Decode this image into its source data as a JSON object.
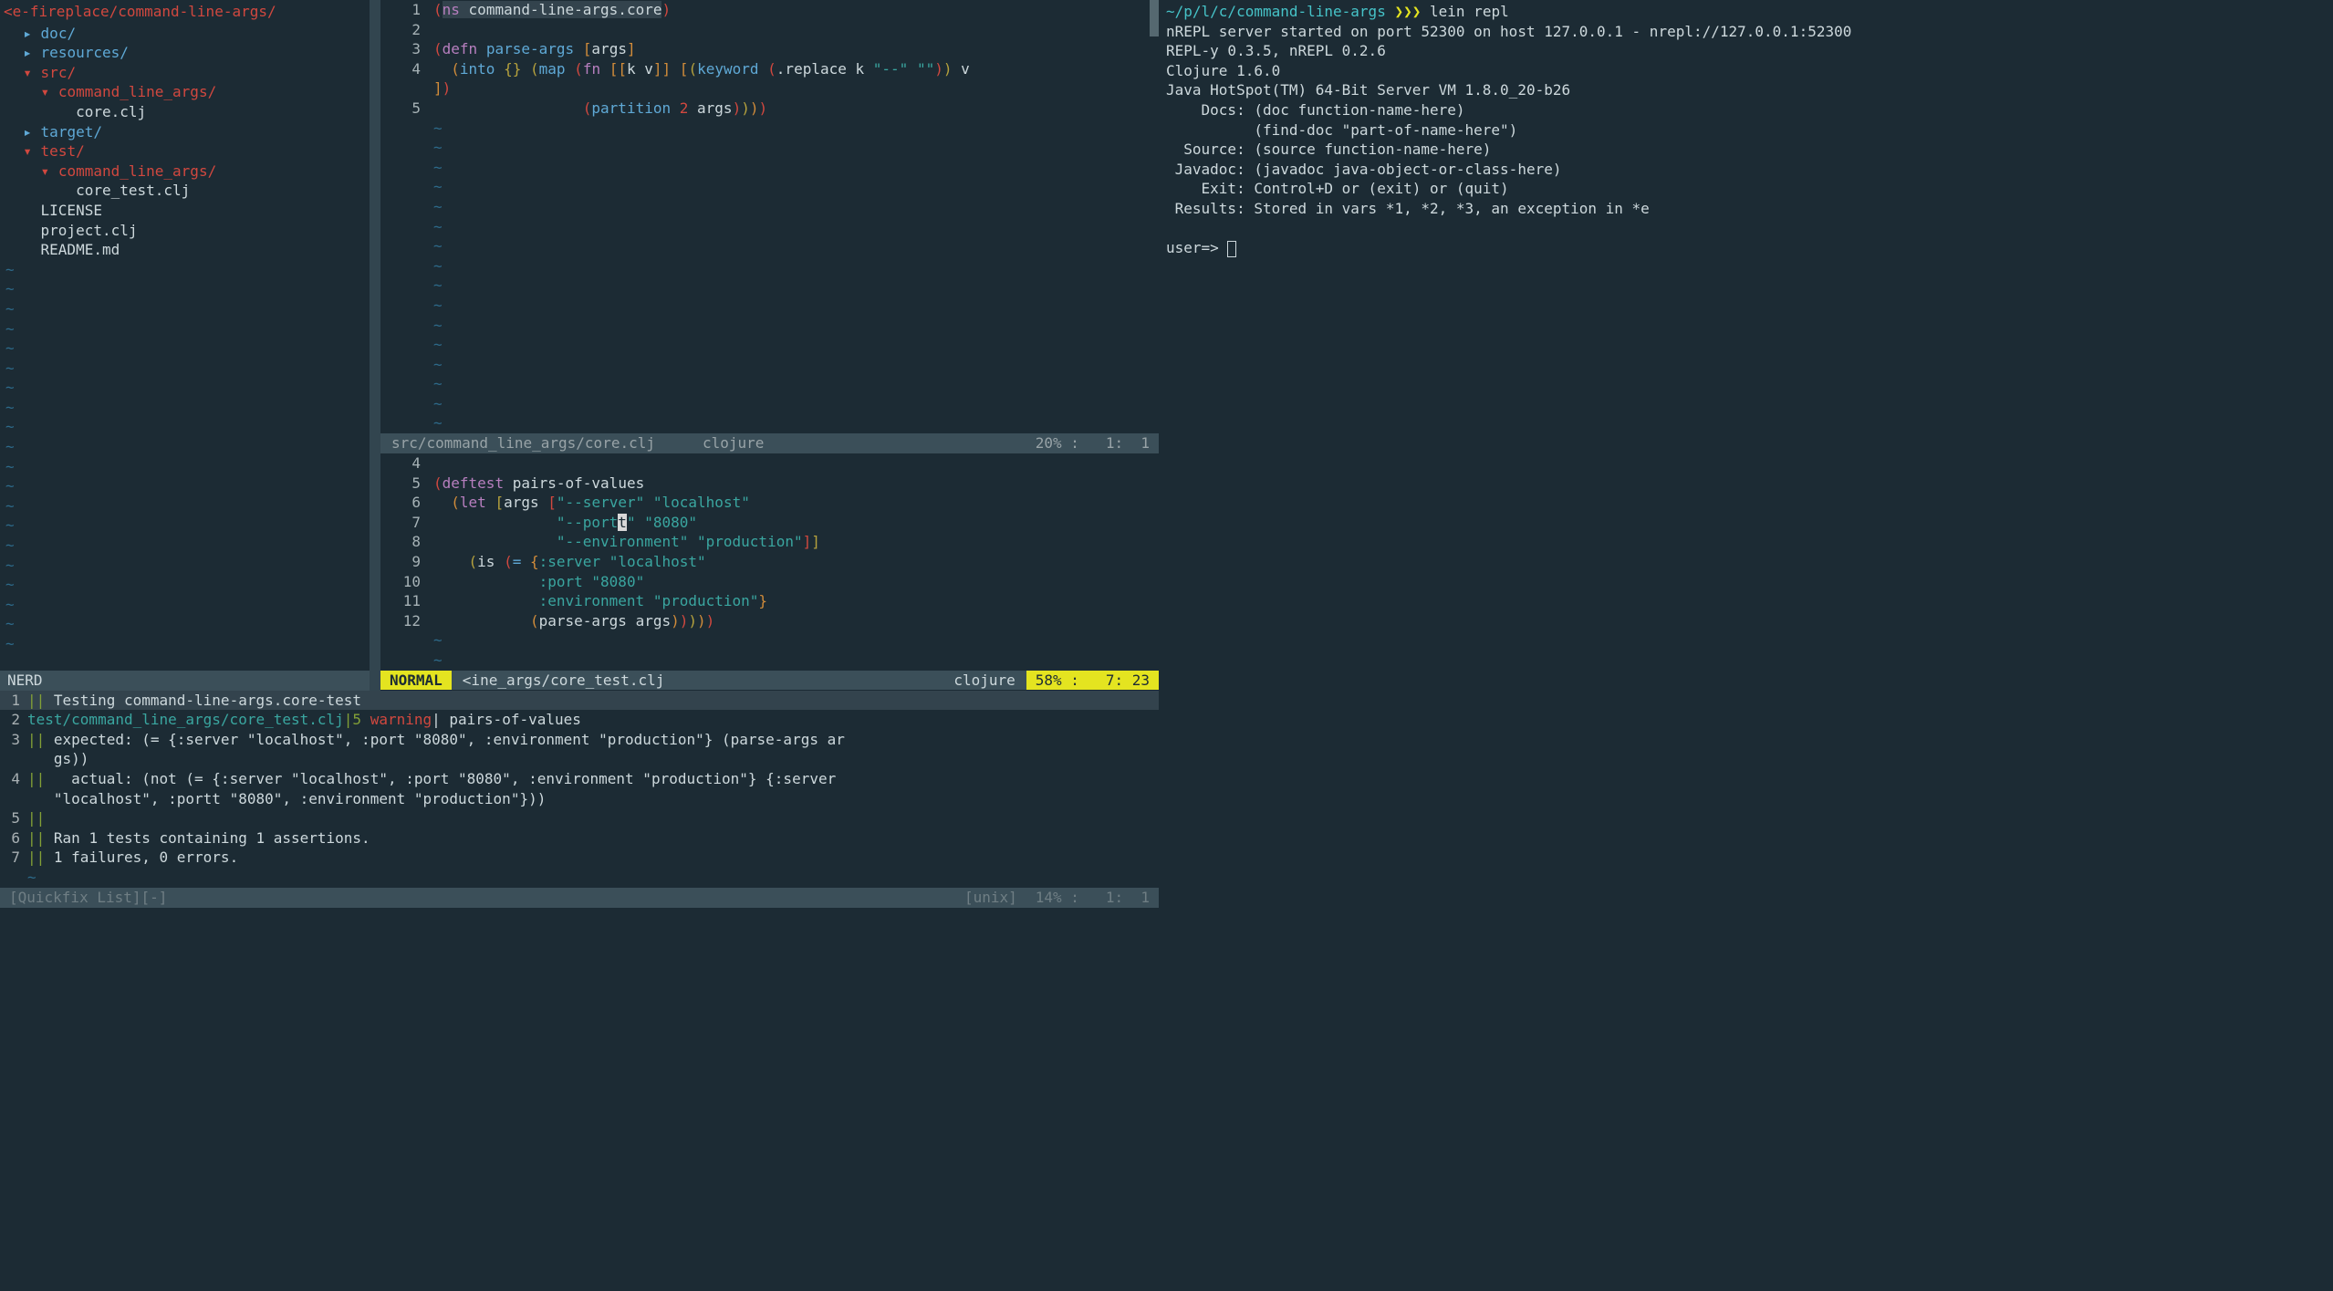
{
  "tree": {
    "path": "<e-fireplace/command-line-args/",
    "items": [
      {
        "indent": 1,
        "arrow": "▸",
        "kind": "dir-closed",
        "label": "doc/"
      },
      {
        "indent": 1,
        "arrow": "▸",
        "kind": "dir-closed",
        "label": "resources/"
      },
      {
        "indent": 1,
        "arrow": "▾",
        "kind": "dir-open",
        "label": "src/"
      },
      {
        "indent": 2,
        "arrow": "▾",
        "kind": "dir-open",
        "label": "command_line_args/"
      },
      {
        "indent": 3,
        "arrow": "",
        "kind": "file",
        "label": "core.clj"
      },
      {
        "indent": 1,
        "arrow": "▸",
        "kind": "dir-closed",
        "label": "target/"
      },
      {
        "indent": 1,
        "arrow": "▾",
        "kind": "dir-open",
        "label": "test/"
      },
      {
        "indent": 2,
        "arrow": "▾",
        "kind": "dir-open",
        "label": "command_line_args/"
      },
      {
        "indent": 3,
        "arrow": "",
        "kind": "file",
        "label": "core_test.clj"
      },
      {
        "indent": 1,
        "arrow": "",
        "kind": "file",
        "label": "LICENSE"
      },
      {
        "indent": 1,
        "arrow": "",
        "kind": "file",
        "label": "project.clj"
      },
      {
        "indent": 1,
        "arrow": "",
        "kind": "file",
        "label": "README.md"
      }
    ],
    "status": "NERD"
  },
  "buf1": {
    "status": {
      "file": "src/command_line_args/core.clj",
      "ft": "clojure",
      "pct": "20% :",
      "pos": "1:  1"
    }
  },
  "buf2": {
    "status": {
      "mode": "NORMAL",
      "file": "<ine_args/core_test.clj",
      "ft": "clojure",
      "pct": "58% :",
      "pos": "7: 23"
    }
  },
  "quickfix": {
    "rows": [
      {
        "n": "1",
        "pre": "|| ",
        "text": "Testing command-line-args.core-test",
        "current": true
      },
      {
        "n": "2",
        "file": "test/command_line_args/core_test.clj",
        "sep": "|",
        "lnum": "5",
        "warn": " warning",
        "rest": "| pairs-of-values"
      },
      {
        "n": "3",
        "pre": "|| ",
        "text": "expected: (= {:server \"localhost\", :port \"8080\", :environment \"production\"} (parse-args ar"
      },
      {
        "n": "",
        "pre": "   ",
        "text": "gs))"
      },
      {
        "n": "4",
        "pre": "||   ",
        "text": "actual: (not (= {:server \"localhost\", :port \"8080\", :environment \"production\"} {:server"
      },
      {
        "n": "",
        "pre": "   ",
        "text": "\"localhost\", :portt \"8080\", :environment \"production\"}))"
      },
      {
        "n": "5",
        "pre": "||",
        "text": ""
      },
      {
        "n": "6",
        "pre": "|| ",
        "text": "Ran 1 tests containing 1 assertions."
      },
      {
        "n": "7",
        "pre": "|| ",
        "text": "1 failures, 0 errors."
      }
    ],
    "status": {
      "title": "[Quickfix List][-]",
      "enc": "[unix]",
      "pct": "14% :",
      "pos": "1:  1"
    }
  },
  "term": {
    "promptPath": "~/p/l/c/command-line-args",
    "promptArrows": "❯❯❯",
    "promptCmd": "lein repl",
    "lines": [
      "nREPL server started on port 52300 on host 127.0.0.1 - nrepl://127.0.0.1:52300",
      "REPL-y 0.3.5, nREPL 0.2.6",
      "Clojure 1.6.0",
      "Java HotSpot(TM) 64-Bit Server VM 1.8.0_20-b26",
      "    Docs: (doc function-name-here)",
      "          (find-doc \"part-of-name-here\")",
      "  Source: (source function-name-here)",
      " Javadoc: (javadoc java-object-or-class-here)",
      "    Exit: Control+D or (exit) or (quit)",
      " Results: Stored in vars *1, *2, *3, an exception in *e"
    ],
    "replPrompt": "user=> "
  }
}
